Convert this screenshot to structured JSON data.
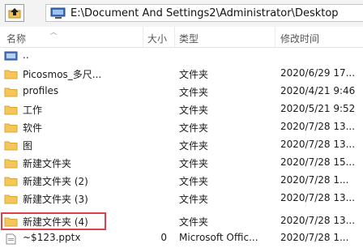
{
  "address": {
    "path": "E:\\Document And Settings2\\Administrator\\Desktop"
  },
  "columns": {
    "name": "名称",
    "size": "大小",
    "type": "类型",
    "modified": "修改时间"
  },
  "rows": [
    {
      "name": "..",
      "type": "",
      "date": "",
      "size": "",
      "icon": "parent-folder-icon"
    },
    {
      "name": "Picosmos_多尺...",
      "type": "文件夹",
      "date": "2020/6/29 17...",
      "size": "",
      "icon": "folder-icon"
    },
    {
      "name": "profiles",
      "type": "文件夹",
      "date": "2020/4/21 9:46",
      "size": "",
      "icon": "folder-icon"
    },
    {
      "name": "工作",
      "type": "文件夹",
      "date": "2020/5/21 9:52",
      "size": "",
      "icon": "folder-icon"
    },
    {
      "name": "软件",
      "type": "文件夹",
      "date": "2020/7/28 13...",
      "size": "",
      "icon": "folder-icon"
    },
    {
      "name": "图",
      "type": "文件夹",
      "date": "2020/7/28 13...",
      "size": "",
      "icon": "folder-icon"
    },
    {
      "name": "新建文件夹",
      "type": "文件夹",
      "date": "2020/7/28 15...",
      "size": "",
      "icon": "folder-icon"
    },
    {
      "name": "新建文件夹 (2)",
      "type": "文件夹",
      "date": "2020/7/28 1...",
      "size": "",
      "icon": "folder-icon"
    },
    {
      "name": "新建文件夹 (3)",
      "type": "文件夹",
      "date": "2020/7/28 13...",
      "size": "",
      "icon": "folder-icon"
    },
    {
      "name": "新建文件夹 (4)",
      "type": "文件夹",
      "date": "2020/7/28 13...",
      "size": "",
      "icon": "folder-icon"
    },
    {
      "name": "~$123.pptx",
      "type": "Microsoft Offic...",
      "date": "2020/7/28 1...",
      "size": "0",
      "icon": "document-icon"
    }
  ],
  "colors": {
    "folder": "#f3c75a",
    "folder_dark": "#d9a535",
    "highlight": "#d8434b"
  }
}
